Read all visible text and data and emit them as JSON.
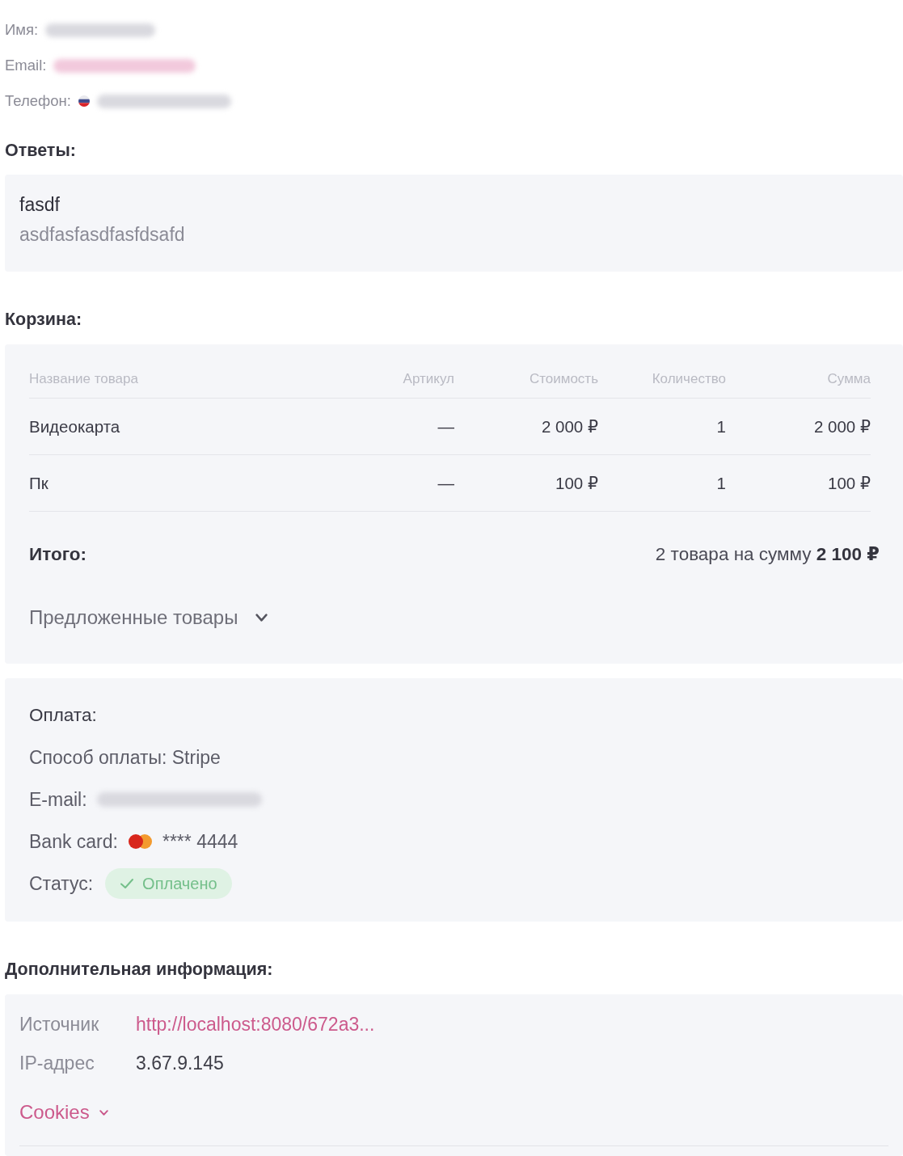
{
  "contact": [
    {
      "label": "Имя:",
      "kind": "text",
      "redacted": true
    },
    {
      "label": "Email:",
      "kind": "email",
      "redacted": true
    },
    {
      "label": "Телефон:",
      "kind": "phone",
      "redacted": true
    }
  ],
  "answers": {
    "title": "Ответы:",
    "items": [
      {
        "question": "fasdf",
        "answer": "asdfasfasdfasfdsafd"
      }
    ]
  },
  "cart": {
    "title": "Корзина:",
    "columns": [
      "Название товара",
      "Артикул",
      "Стоимость",
      "Количество",
      "Сумма"
    ],
    "rows": [
      [
        "Видеокарта",
        "—",
        "2 000 ₽",
        "1",
        "2 000 ₽"
      ],
      [
        "Пк",
        "—",
        "100 ₽",
        "1",
        "100 ₽"
      ]
    ],
    "total_label": "Итого:",
    "total_text": "2 товара на сумму **2 100 ₽**",
    "suggested": {
      "label": "Предложенные товары",
      "expanded": false
    }
  },
  "payment": {
    "title": "Оплата:",
    "method": "Способ оплаты: Stripe",
    "email": {
      "label": "E-mail:",
      "redacted": true
    },
    "card": {
      "label": "Bank card:",
      "number": "**** 4444"
    },
    "status": {
      "label": "Статус:",
      "value": "Оплачено",
      "kind": "success"
    }
  },
  "extra": {
    "title": "Дополнительная информация:",
    "rows": [
      {
        "label": "Источник",
        "value": "http://localhost:8080/672a3...",
        "kind": "link"
      },
      {
        "label": "IP-адрес",
        "value": "3.67.9.145",
        "kind": "text"
      }
    ],
    "cookies": {
      "label": "Cookies",
      "expanded": false
    }
  }
}
